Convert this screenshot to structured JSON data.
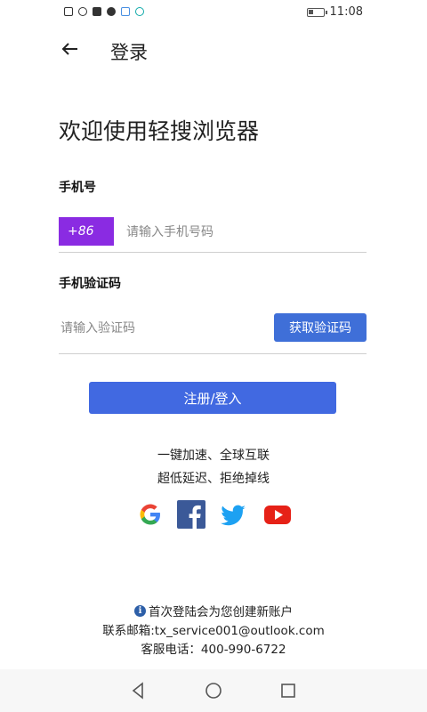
{
  "status_bar": {
    "time": "11:08",
    "battery_level": 0.35,
    "icons": [
      "sim-icon",
      "wifi-icon",
      "phone-icon",
      "tiktok-icon",
      "bluetooth-icon",
      "play-icon"
    ]
  },
  "header": {
    "title": "登录",
    "back_icon": "arrow-left-icon"
  },
  "welcome": "欢迎使用轻搜浏览器",
  "phone": {
    "label": "手机号",
    "country_code": "+86",
    "placeholder": "请输入手机号码",
    "value": ""
  },
  "code": {
    "label": "手机验证码",
    "placeholder": "请输入验证码",
    "value": "",
    "get_code_button": "获取验证码"
  },
  "submit_button": "注册/登入",
  "slogans": [
    "一键加速、全球互联",
    "超低延迟、拒绝掉线"
  ],
  "social_login": [
    "google-icon",
    "facebook-icon",
    "twitter-icon",
    "youtube-icon"
  ],
  "notice": {
    "first_login": "首次登陆会为您创建新账户",
    "email": "联系邮箱:tx_service001@outlook.com",
    "phone": "客服电话：400-990-6722"
  },
  "colors": {
    "primary_button": "#4169e1",
    "country_code_bg": "#8a2be2",
    "get_code_bg": "#3f6fd8"
  }
}
